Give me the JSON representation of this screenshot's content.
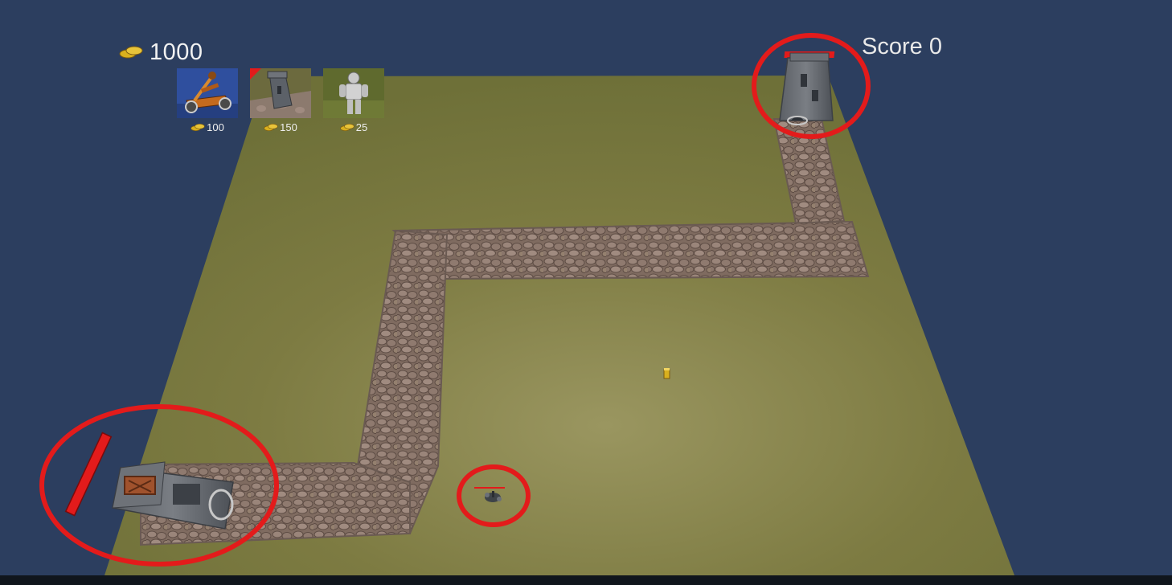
{
  "hud": {
    "gold_icon": "gold-coins-icon",
    "gold": "1000",
    "score_label": "Score 0"
  },
  "shop": {
    "items": [
      {
        "unit": "catapult",
        "cost": "100",
        "icon": "catapult-icon"
      },
      {
        "unit": "tower",
        "cost": "150",
        "icon": "tower-icon"
      },
      {
        "unit": "knight",
        "cost": "25",
        "icon": "knight-icon"
      }
    ]
  },
  "colors": {
    "background": "#2c3e5f",
    "ground": "#7c7a3f",
    "path": "#8a7468",
    "highlight": "#e31b1b",
    "gold": "#d9b01e"
  }
}
